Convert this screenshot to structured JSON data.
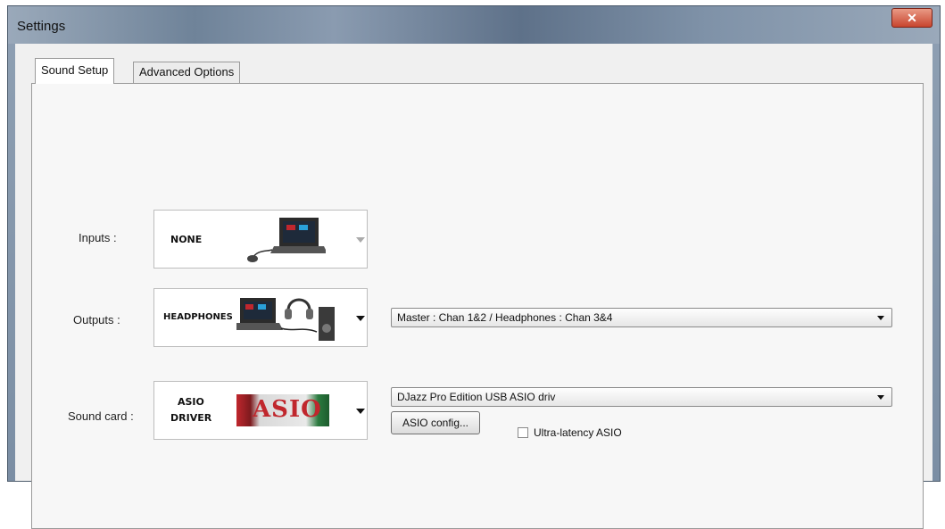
{
  "window": {
    "title": "Settings",
    "close_glyph": "✕"
  },
  "tabs": [
    {
      "label": "Sound Setup",
      "active": true
    },
    {
      "label": "Advanced Options",
      "active": false
    }
  ],
  "inputs": {
    "label": "Inputs :",
    "device": "NONE",
    "icon": "laptop-with-mouse-icon"
  },
  "outputs": {
    "label": "Outputs :",
    "device": "HEADPHONES",
    "icon": "laptop-headphones-speaker-icon",
    "routing": "Master : Chan 1&2 / Headphones : Chan 3&4"
  },
  "soundcard": {
    "label": "Sound card :",
    "device_line1": "ASIO",
    "device_line2": "DRIVER",
    "logo_text": "ASIO",
    "driver": "DJazz Pro Edition USB ASIO driv",
    "config_button": "ASIO config...",
    "ultra_latency_label": "Ultra-latency ASIO",
    "ultra_latency_checked": false
  },
  "colors": {
    "asio_red": "#c0272d",
    "titlebar_blue": "#6f8399"
  }
}
